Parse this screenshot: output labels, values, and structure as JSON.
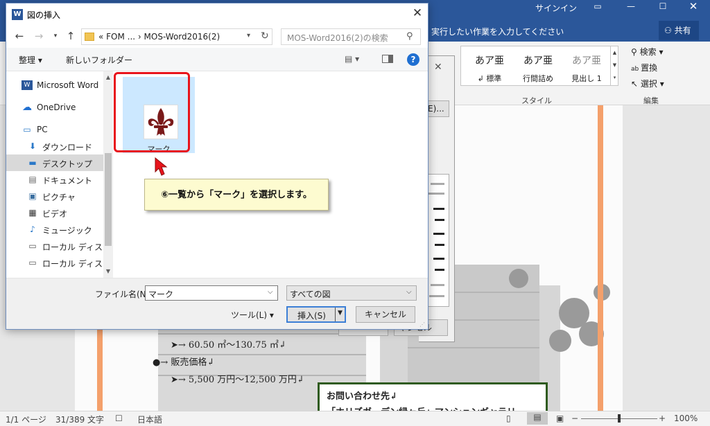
{
  "word": {
    "signin": "サインイン",
    "tell_me": "実行したい作業を入力してください",
    "share": "共有",
    "styles": [
      {
        "sample": "あア亜",
        "name": "↲ 標準"
      },
      {
        "sample": "あア亜",
        "name": "行間詰め"
      },
      {
        "sample": "あア亜",
        "name": "見出し 1"
      }
    ],
    "styles_group_label": "スタイル",
    "edit_items": {
      "find": "検索",
      "replace": "置換",
      "select": "選択"
    },
    "edit_group_label": "編集",
    "doc_lines": {
      "area": "➤→ 60.50 ㎡～130.75 ㎡↲",
      "price_heading": "●→ 販売価格↲",
      "price": "➤→ 5,500 万円～12,500 万円↲",
      "contact_title": "お問い合わせ先↲",
      "contact_sub": "「ホリズガーデン緑ヶ丘」マンションギャラリー"
    },
    "status": {
      "page": "1/1 ページ",
      "words": "31/389 文字",
      "language": "日本語",
      "zoom": "100%"
    }
  },
  "bg_dialog": {
    "button1": "E)...",
    "button3": "ャンセル"
  },
  "dialog": {
    "title": "図の挿入",
    "title_icon": "W",
    "address": "« FOM ... › MOS-Word2016(2)",
    "search_placeholder": "MOS-Word2016(2)の検索",
    "organize": "整理 ▾",
    "new_folder": "新しいフォルダー",
    "nav_items": [
      {
        "label": "Microsoft Word",
        "icon": "word-icon"
      },
      {
        "label": "OneDrive",
        "icon": "cloud-icon"
      },
      {
        "label": "PC",
        "icon": "pc-icon"
      },
      {
        "label": "ダウンロード",
        "icon": "download-icon"
      },
      {
        "label": "デスクトップ",
        "icon": "desktop-icon"
      },
      {
        "label": "ドキュメント",
        "icon": "document-icon"
      },
      {
        "label": "ピクチャ",
        "icon": "picture-icon"
      },
      {
        "label": "ビデオ",
        "icon": "video-icon"
      },
      {
        "label": "ミュージック",
        "icon": "music-icon"
      },
      {
        "label": "ローカル ディスク (C",
        "icon": "disk-icon"
      },
      {
        "label": "ローカル ディスク (D",
        "icon": "disk-icon"
      }
    ],
    "selected_nav": "デスクトップ",
    "file": {
      "name": "マーク",
      "icon": "fleur-de-lis-icon"
    },
    "callout": "⑥一覧から「マーク」を選択します。",
    "filename_label": "ファイル名(N):",
    "filename_value": "マーク",
    "filetype_value": "すべての図",
    "tools": "ツール(L)",
    "insert": "挿入(S)",
    "cancel": "キャンセル"
  },
  "colors": {
    "word_blue": "#2b579a",
    "selection": "#cce8ff",
    "highlight_red": "#e8141c",
    "callout_bg": "#fdfbd0",
    "accent_orange": "#f4a06b"
  }
}
